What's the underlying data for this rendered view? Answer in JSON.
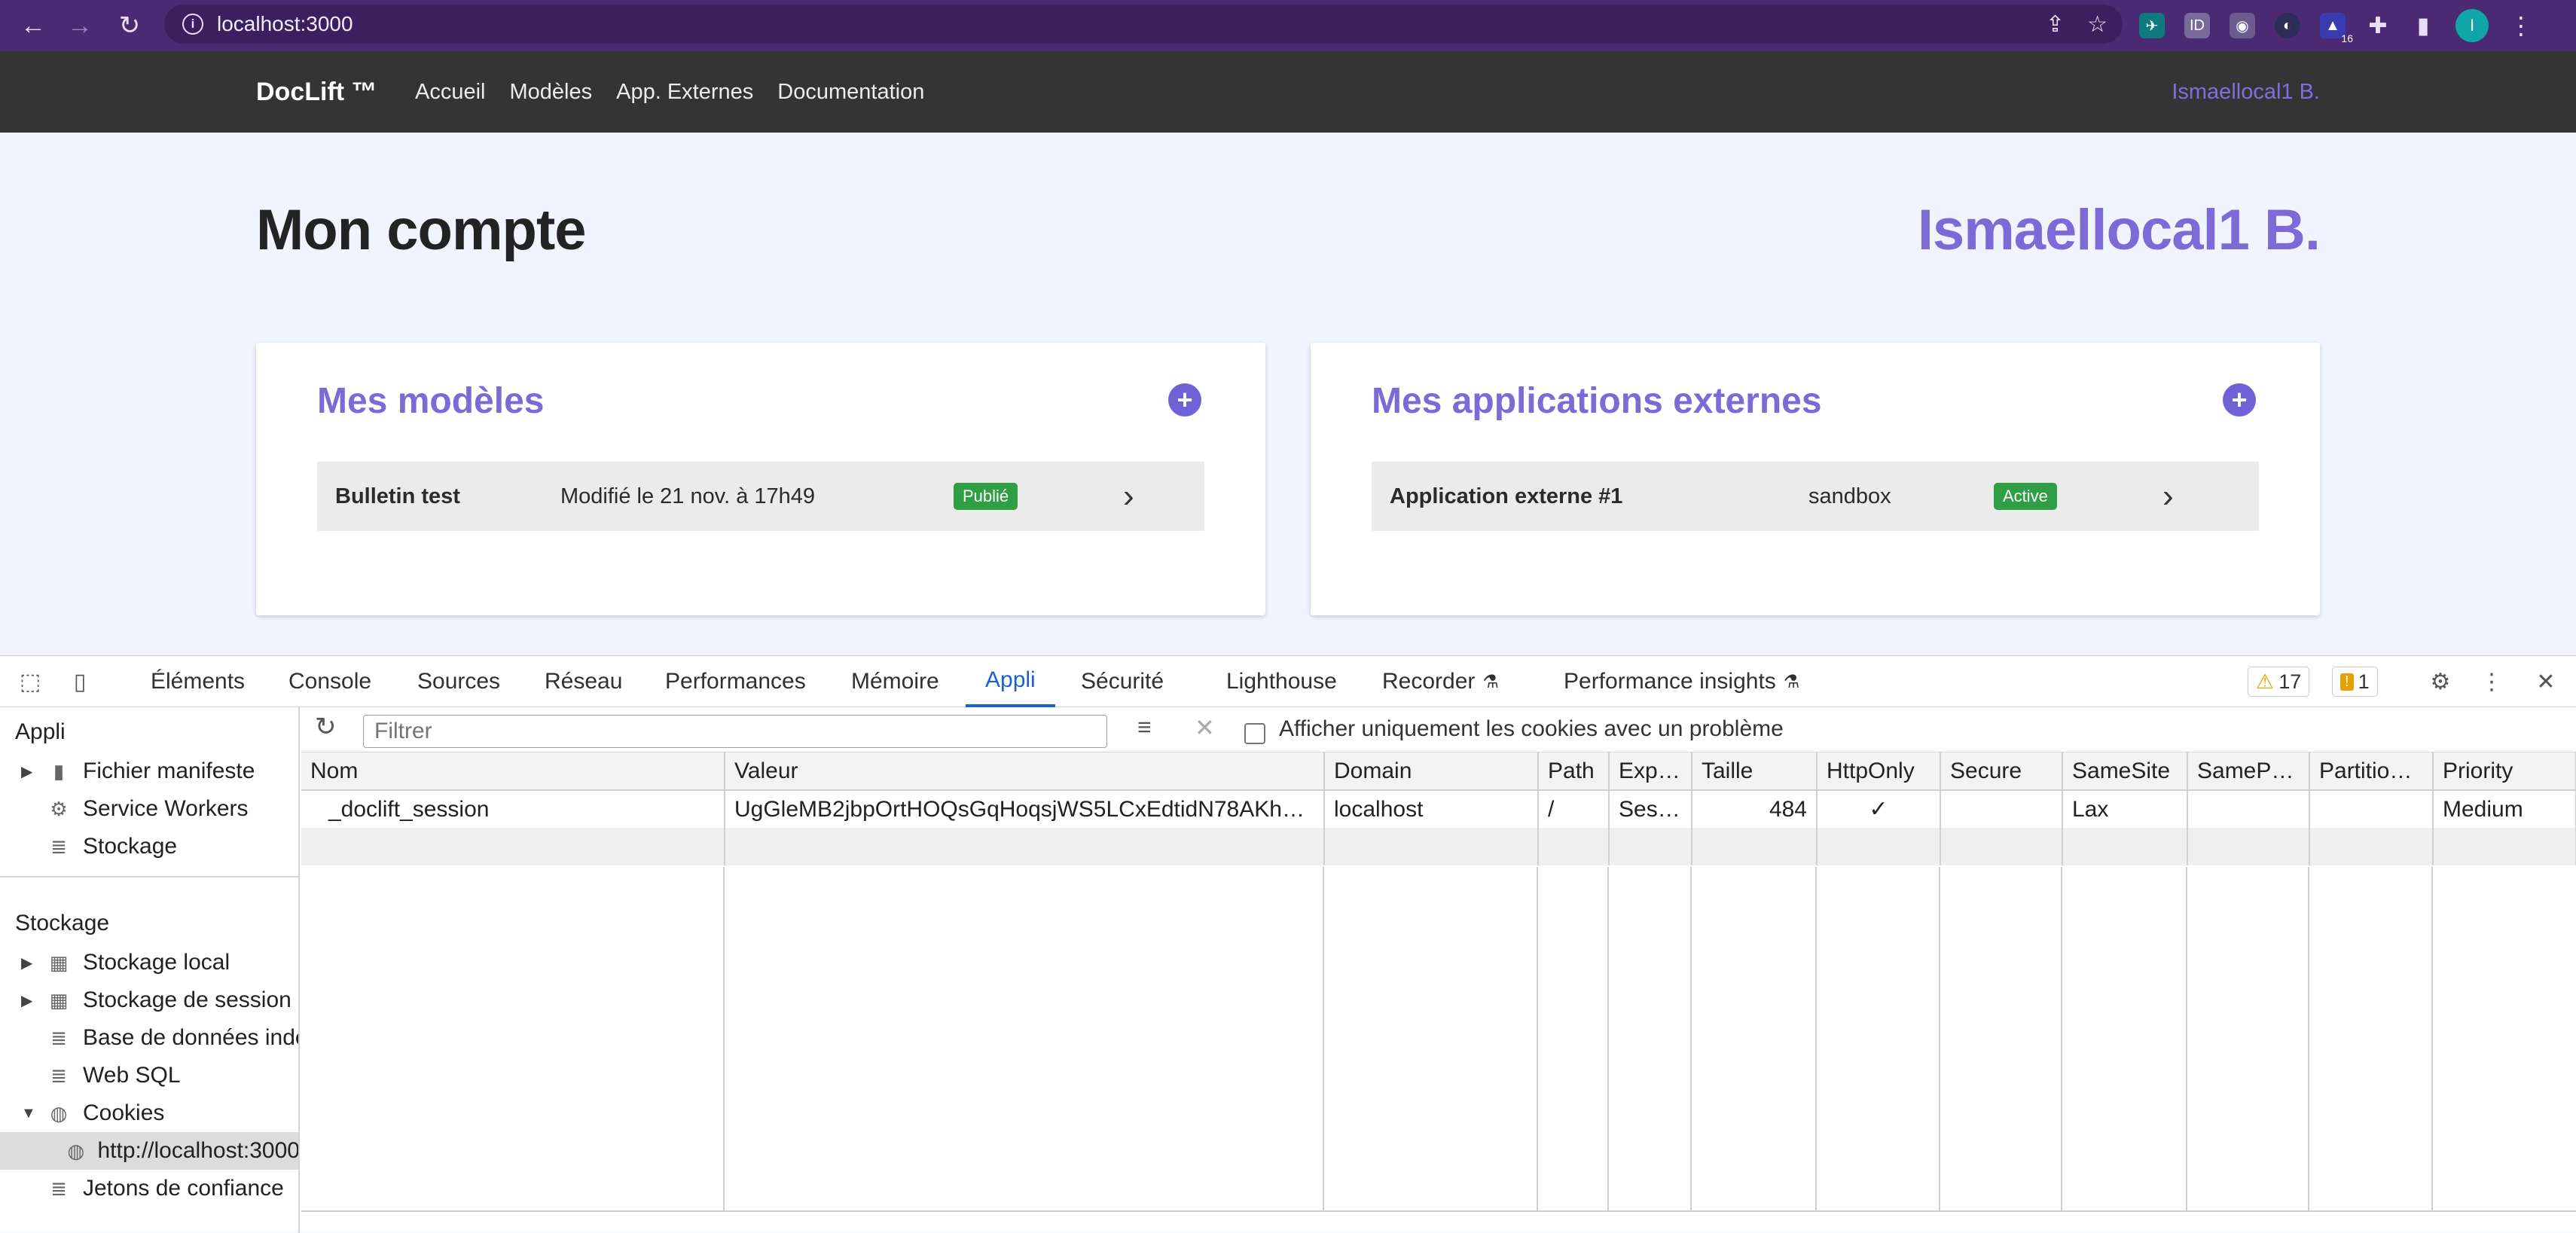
{
  "browser": {
    "url": "localhost:3000",
    "extension_badge": "16",
    "profile_initial": "I"
  },
  "navbar": {
    "brand": "DocLift ™",
    "links": [
      "Accueil",
      "Modèles",
      "App. Externes",
      "Documentation"
    ],
    "user": "Ismaellocal1 B."
  },
  "page": {
    "title": "Mon compte",
    "user_heading": "Ismaellocal1 B."
  },
  "models_card": {
    "title": "Mes modèles",
    "row": {
      "name": "Bulletin test",
      "meta": "Modifié le 21 nov. à 17h49",
      "status": "Publié"
    }
  },
  "apps_card": {
    "title": "Mes applications externes",
    "row": {
      "name": "Application externe #1",
      "meta": "sandbox",
      "status": "Active"
    }
  },
  "devtools": {
    "tabs": [
      "Éléments",
      "Console",
      "Sources",
      "Réseau",
      "Performances",
      "Mémoire",
      "Appli",
      "Sécurité",
      "Lighthouse",
      "Recorder",
      "Performance insights"
    ],
    "active_tab": "Appli",
    "warnings_count": "17",
    "issues_count": "1",
    "sidebar": {
      "section_app": "Appli",
      "app_items": [
        "Fichier manifeste",
        "Service Workers",
        "Stockage"
      ],
      "section_storage": "Stockage",
      "storage_items": [
        "Stockage local",
        "Stockage de session",
        "Base de données indexée",
        "Web SQL",
        "Cookies",
        "http://localhost:3000",
        "Jetons de confiance"
      ]
    },
    "filter_placeholder": "Filtrer",
    "only_issues_label": "Afficher uniquement les cookies avec un problème",
    "columns": [
      "Nom",
      "Valeur",
      "Domain",
      "Path",
      "Expi…",
      "Taille",
      "HttpOnly",
      "Secure",
      "SameSite",
      "SameP…",
      "Partitio…",
      "Priority"
    ],
    "cookie": {
      "name": "_doclift_session",
      "value": "UgGleMB2jbpOrtHOQsGqHoqsjWS5LCxEdtidN78AKh…",
      "domain": "localhost",
      "path": "/",
      "expires": "Ses…",
      "size": "484",
      "httponly": "✓",
      "secure": "",
      "samesite": "Lax",
      "sameparty": "",
      "partition": "",
      "priority": "Medium"
    }
  },
  "colors": {
    "chrome": "#4b2a74",
    "appbar": "#343434",
    "accent": "#7e6ad6",
    "badge_green": "#2f9e44",
    "devtools_active": "#1a63c9"
  }
}
